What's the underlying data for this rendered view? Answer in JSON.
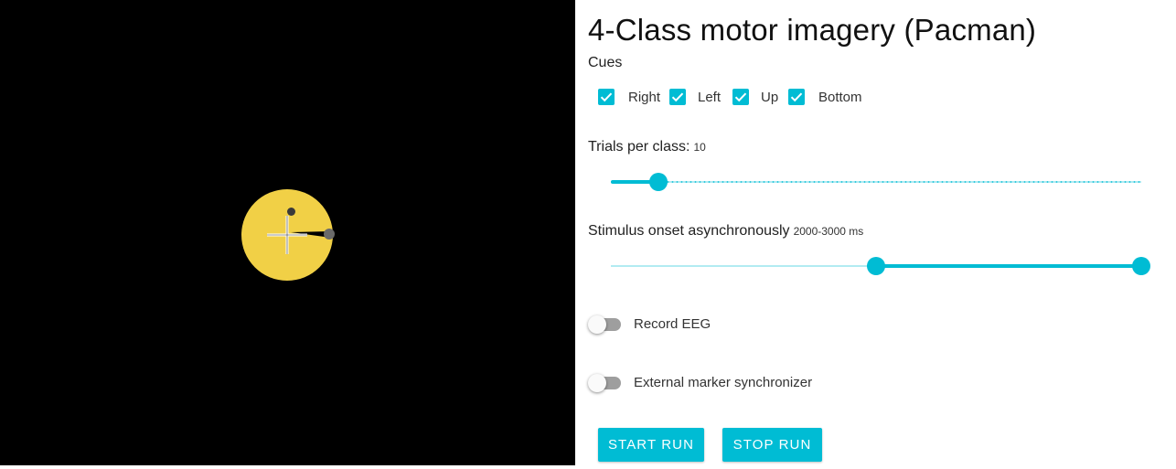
{
  "app": {
    "title": "4-Class motor imagery (Pacman)",
    "accent_color": "#00bcd4"
  },
  "stage": {
    "background": "#000000",
    "pacman_color": "#f1d046",
    "icon": "pacman-with-fixation-cross"
  },
  "cues": {
    "label": "Cues",
    "items": [
      {
        "label": "Right",
        "checked": true
      },
      {
        "label": "Left",
        "checked": true
      },
      {
        "label": "Up",
        "checked": true
      },
      {
        "label": "Bottom",
        "checked": true
      }
    ]
  },
  "trials": {
    "label": "Trials per class:",
    "value": "10",
    "fraction": 0.09
  },
  "onset": {
    "label": "Stimulus onset asynchronously",
    "value": "2000-3000 ms",
    "range_fraction": [
      0.5,
      1.0
    ]
  },
  "toggles": [
    {
      "label": "Record EEG",
      "on": false
    },
    {
      "label": "External marker synchronizer",
      "on": false
    }
  ],
  "buttons": {
    "start": "START RUN",
    "stop": "STOP RUN"
  }
}
